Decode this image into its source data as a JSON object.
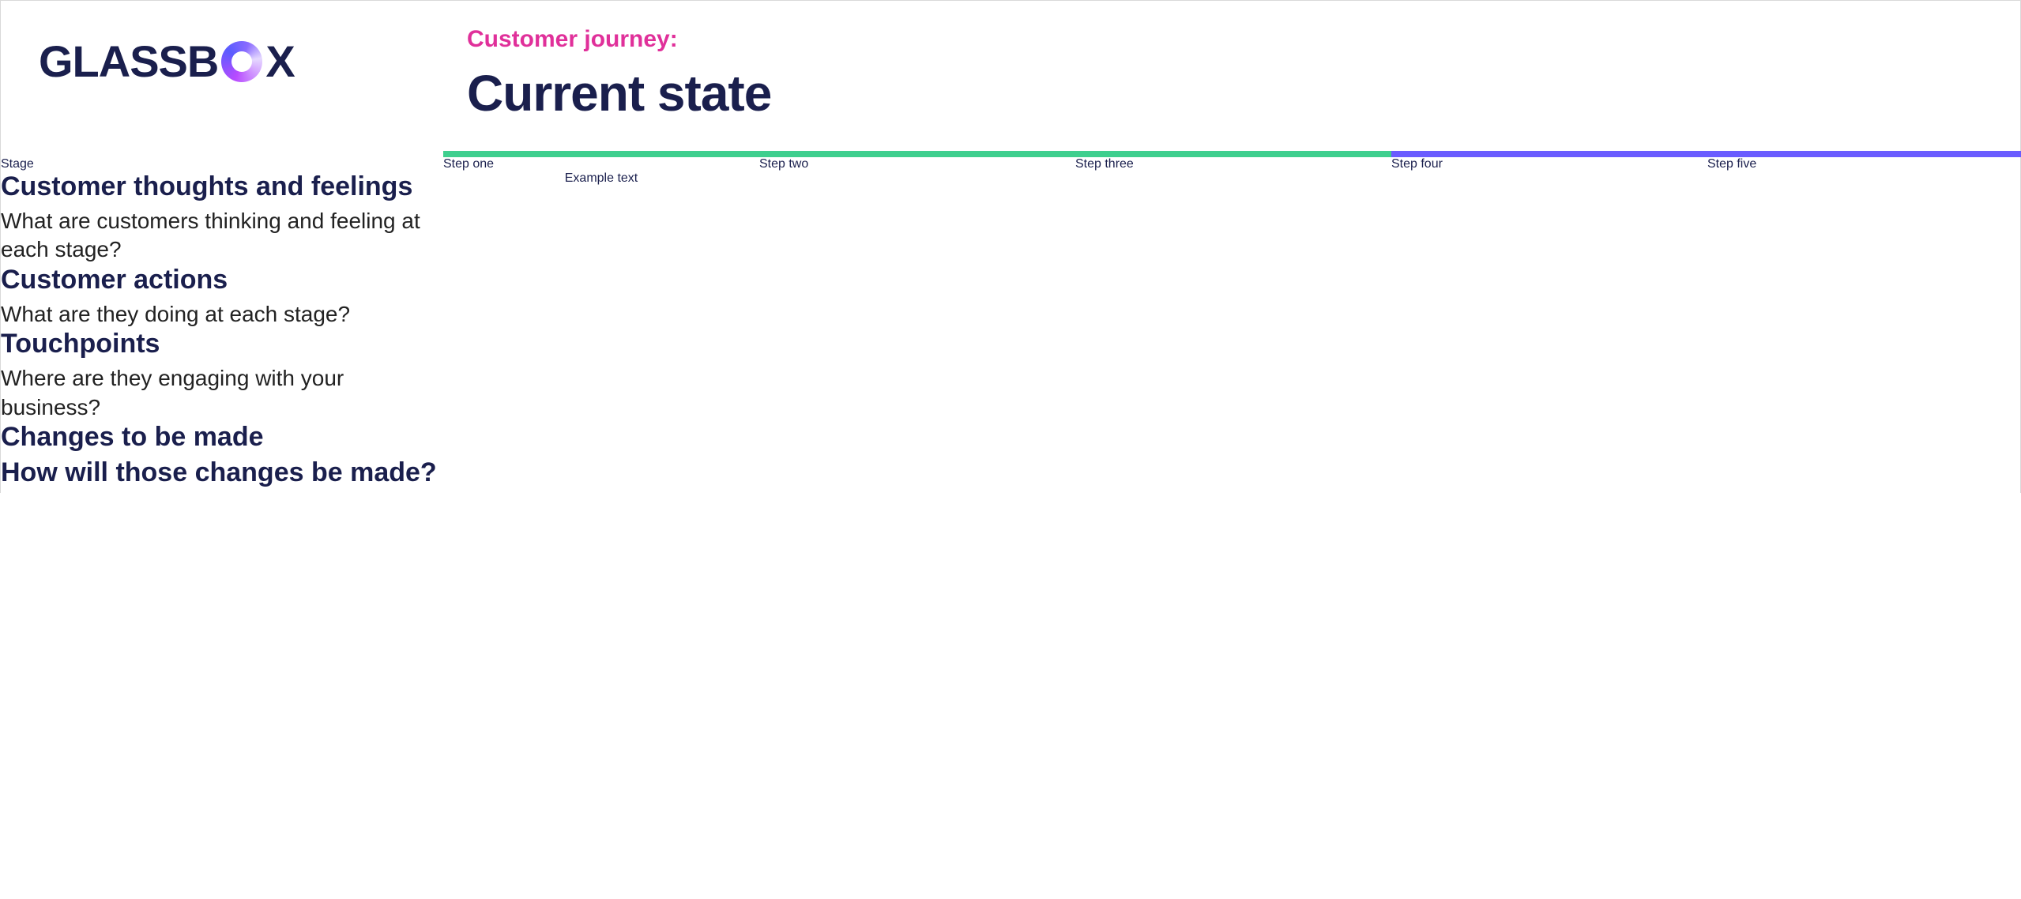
{
  "logo": {
    "part1": "GLASSB",
    "part2": "X"
  },
  "eyebrow": "Customer journey:",
  "title": "Current state",
  "stage_header": "Stage",
  "steps": [
    {
      "label": "Step one",
      "bar": "green"
    },
    {
      "label": "Step two",
      "bar": "green"
    },
    {
      "label": "Step three",
      "bar": "green"
    },
    {
      "label": "Step four",
      "bar": "purple"
    },
    {
      "label": "Step five",
      "bar": "purple"
    }
  ],
  "rows": [
    {
      "title": "Customer thoughts and feelings",
      "sub": "What are customers thinking and feeling at each stage?",
      "values": [
        "Example text",
        "",
        "",
        "",
        ""
      ]
    },
    {
      "title": "Customer actions",
      "sub": "What are they doing at each stage?",
      "values": [
        "",
        "",
        "",
        "",
        ""
      ]
    },
    {
      "title": "Touchpoints",
      "sub": "Where are they engaging with your business?",
      "values": [
        "",
        "",
        "",
        "",
        ""
      ]
    },
    {
      "title": "Changes to be made",
      "sub": "",
      "values": [
        "",
        "",
        "",
        "",
        ""
      ]
    },
    {
      "title": "How will those changes be made?",
      "sub": "",
      "values": [
        "",
        "",
        "",
        "",
        ""
      ]
    }
  ]
}
